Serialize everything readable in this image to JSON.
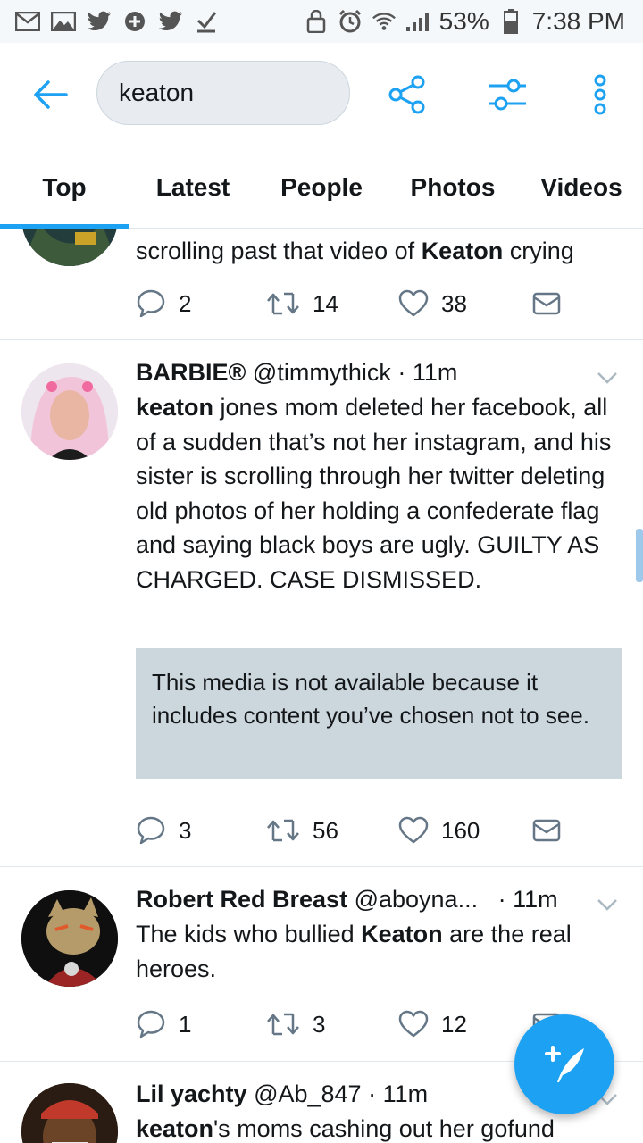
{
  "status_bar": {
    "battery": "53%",
    "time": "7:38 PM"
  },
  "search": {
    "query": "keaton"
  },
  "tabs": [
    {
      "label": "Top",
      "active": true
    },
    {
      "label": "Latest"
    },
    {
      "label": "People"
    },
    {
      "label": "Photos"
    },
    {
      "label": "Videos"
    }
  ],
  "tweets": [
    {
      "text_pre": "scrolling past that video of ",
      "text_bold": "Keaton",
      "text_post": " crying",
      "replies": "2",
      "retweets": "14",
      "likes": "38"
    },
    {
      "name": "BARBIE®",
      "handle": "@timmythick",
      "time": "· 11m",
      "text_bold": "keaton",
      "text_post": " jones mom deleted her facebook, all of a sudden that’s not her instagram, and his sister is scrolling through her twitter deleting old photos of her holding a confederate flag and saying black boys are ugly. GUILTY AS CHARGED. CASE DISMISSED.",
      "media_notice": "This media is not available because it includes content you’ve chosen not to see.",
      "replies": "3",
      "retweets": "56",
      "likes": "160"
    },
    {
      "name": "Robert Red Breast",
      "handle": "@aboyna...",
      "time": "· 11m",
      "text_pre": "The kids who bullied ",
      "text_bold": "Keaton",
      "text_post": " are the real heroes.",
      "replies": "1",
      "retweets": "3",
      "likes": "12"
    },
    {
      "name": "Lil yachty",
      "handle": "@Ab_847",
      "time": "· 11m",
      "text_bold": "keaton",
      "text_post": "'s moms cashing out her gofund"
    }
  ],
  "colors": {
    "accent": "#1da1f2",
    "divider": "#e1e8ed",
    "media_bg": "#ccd6dd"
  }
}
